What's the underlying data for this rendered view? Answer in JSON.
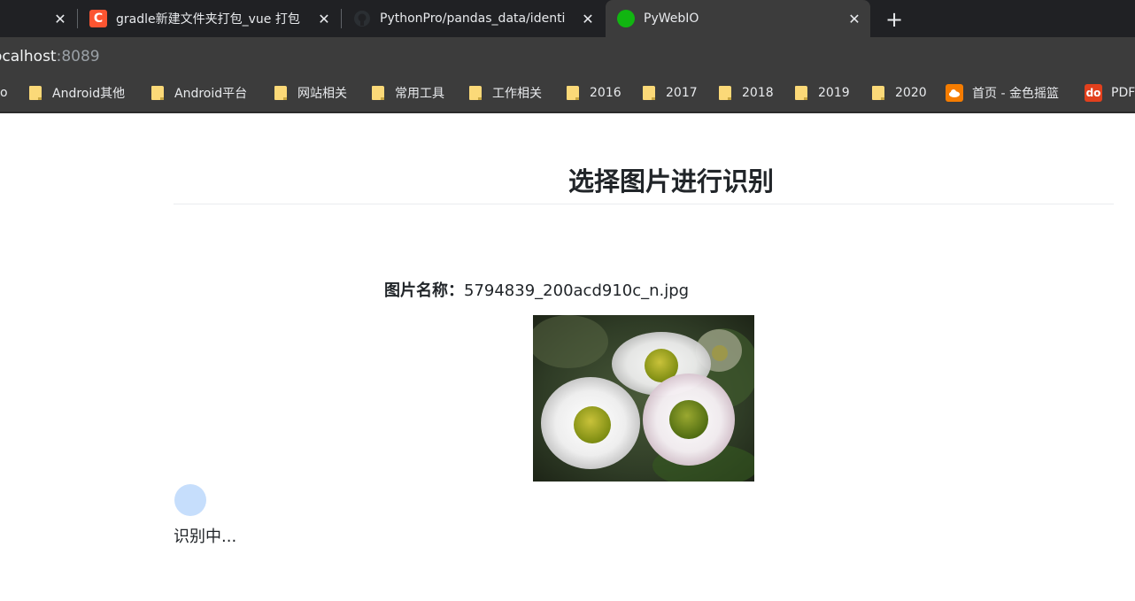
{
  "tabs": [
    {
      "title": "",
      "close_glyph": "✕"
    },
    {
      "title": "gradle新建文件夹打包_vue 打包",
      "favicon_letter": "C",
      "favicon_color": "#fc5531",
      "close_glyph": "✕"
    },
    {
      "title": "PythonPro/pandas_data/identi",
      "favicon_color": "#24292e",
      "close_glyph": "✕"
    },
    {
      "title": "PyWebIO",
      "favicon_color": "#11b511",
      "close_glyph": "✕",
      "active": true
    }
  ],
  "new_tab_glyph": "+",
  "address_bar": {
    "host": "ocalhost",
    "port": ":8089"
  },
  "bookmarks": [
    {
      "label": "o",
      "icon": "none"
    },
    {
      "label": "Android其他",
      "icon": "folder-icon"
    },
    {
      "label": "Android平台",
      "icon": "folder-icon"
    },
    {
      "label": "网站相关",
      "icon": "folder-icon"
    },
    {
      "label": "常用工具",
      "icon": "folder-icon"
    },
    {
      "label": "工作相关",
      "icon": "folder-icon"
    },
    {
      "label": "2016",
      "icon": "folder-icon"
    },
    {
      "label": "2017",
      "icon": "folder-icon"
    },
    {
      "label": "2018",
      "icon": "folder-icon"
    },
    {
      "label": "2019",
      "icon": "folder-icon"
    },
    {
      "label": "2020",
      "icon": "folder-icon"
    },
    {
      "label": "首页 - 金色摇篮",
      "icon": "cloud-icon",
      "badge_color": "#f57c00"
    },
    {
      "label": "PDF",
      "icon": "do-icon",
      "badge_text": "do",
      "badge_color": "#e2401d"
    }
  ],
  "page": {
    "title": "选择图片进行识别",
    "caption_label": "图片名称：",
    "caption_value": "5794839_200acd910c_n.jpg",
    "status": "识别中..."
  },
  "colors": {
    "text": "#212529",
    "spinner": "#c6defc",
    "chrome_dark": "#202124",
    "chrome": "#3c3c3c"
  }
}
